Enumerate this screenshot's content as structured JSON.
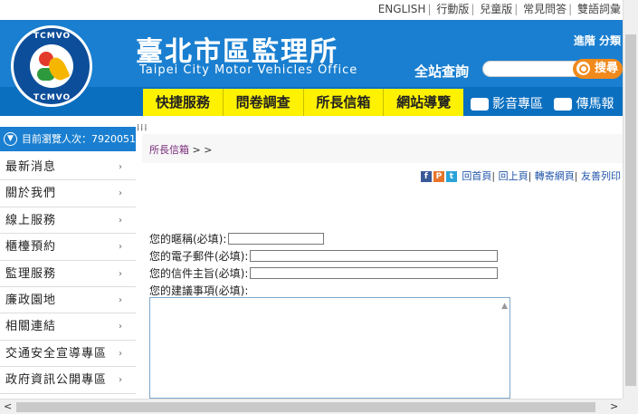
{
  "toplinks": [
    "ENGLISH",
    "行動版",
    "兒童版",
    "常見問答",
    "雙語詞彙"
  ],
  "header": {
    "title_cn": "臺北市區監理所",
    "title_en": "Taipei City Motor Vehicles Office",
    "logo_text": "TCMVO",
    "right_text": "進階 分類",
    "search_label": "全站查詢",
    "search_button": "搜尋",
    "search_value": ""
  },
  "nav": {
    "items": [
      "快捷服務",
      "問卷調查",
      "所長信箱",
      "網站導覽"
    ],
    "media": "影音專區",
    "news": "傳馬報"
  },
  "visitor": {
    "label": "目前瀏覽人次：7920051"
  },
  "sidebar": {
    "items": [
      "最新消息",
      "關於我們",
      "線上服務",
      "櫃檯預約",
      "監理服務",
      "廉政園地",
      "相關連結",
      "交通安全宣導專區",
      "政府資訊公開專區"
    ]
  },
  "breadcrumb": {
    "link": "所長信箱",
    "suffix": " > >"
  },
  "tools": {
    "links": [
      "回首頁",
      "回上頁",
      "轉寄網頁",
      "友善列印"
    ]
  },
  "form": {
    "nickname_label": "您的暱稱(必填):",
    "email_label": "您的電子郵件(必填):",
    "subject_label": "您的信件主旨(必填):",
    "suggestion_label": "您的建議事項(必填):",
    "nickname_value": "",
    "email_value": "",
    "subject_value": ""
  },
  "colors": {
    "header_blue": "#1a7fd0",
    "nav_yellow": "#fff200",
    "search_orange": "#f08a1c"
  }
}
